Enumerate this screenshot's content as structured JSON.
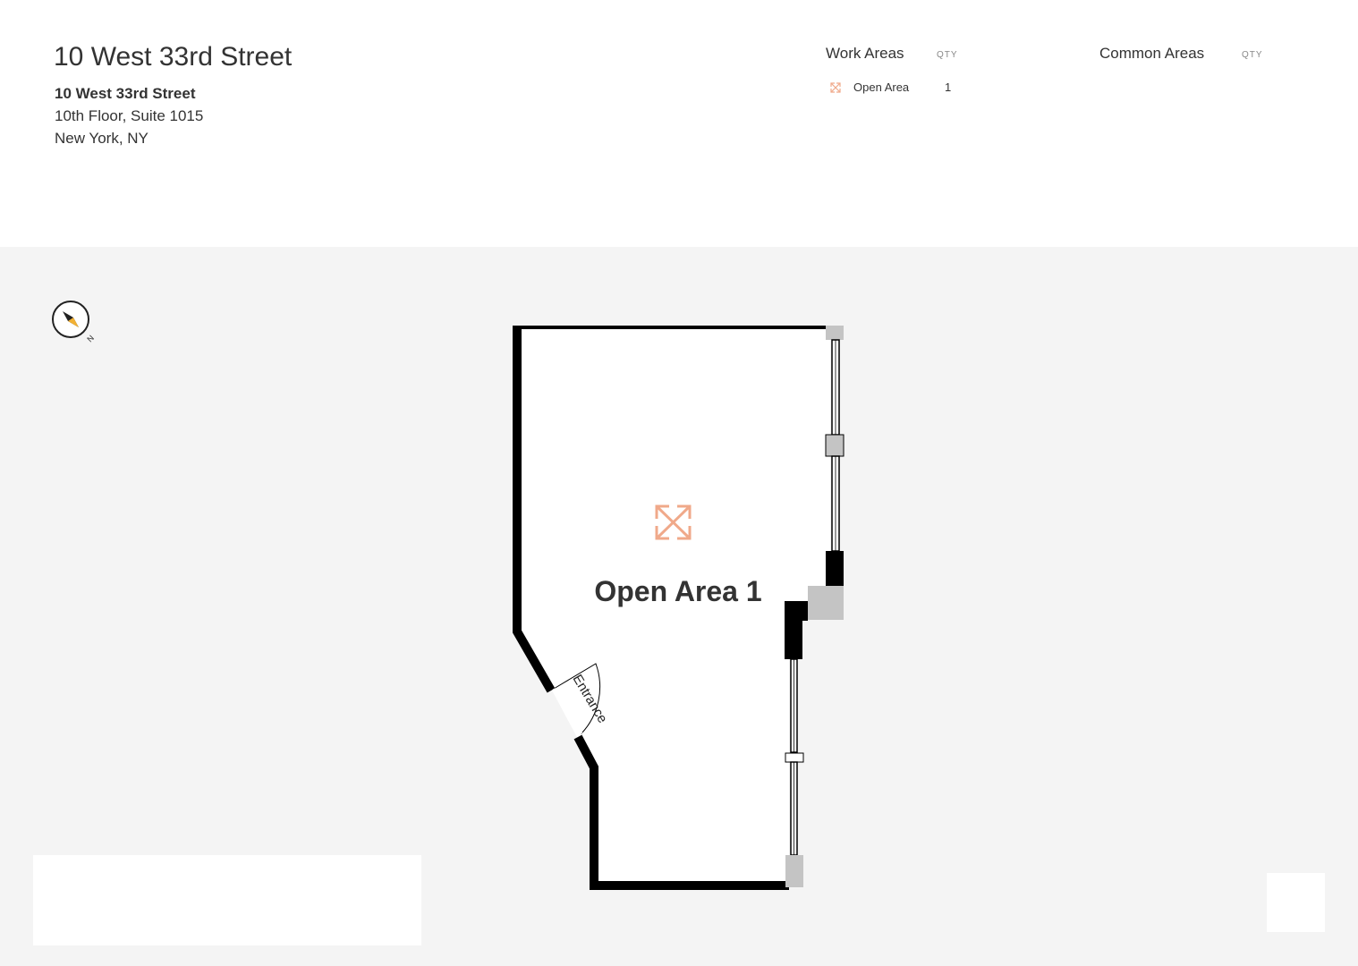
{
  "header": {
    "title": "10 West 33rd Street",
    "address_line1": "10 West 33rd Street",
    "address_line2": "10th Floor, Suite 1015",
    "address_line3": "New York, NY"
  },
  "legend": {
    "work_areas": {
      "heading": "Work Areas",
      "qty_label": "QTY",
      "items": [
        {
          "label": "Open Area",
          "qty": "1",
          "icon": "expand-arrows-icon",
          "color": "#f0a98a"
        }
      ]
    },
    "common_areas": {
      "heading": "Common Areas",
      "qty_label": "QTY",
      "items": []
    }
  },
  "floorplan": {
    "room_label": "Open Area 1",
    "entrance_label": "Entrance",
    "compass_label": "N",
    "room_icon": "expand-arrows-icon",
    "accent_color": "#f0a98a",
    "wall_color": "#000000",
    "window_color": "#bbbbbb",
    "background_color": "#f4f4f4"
  }
}
